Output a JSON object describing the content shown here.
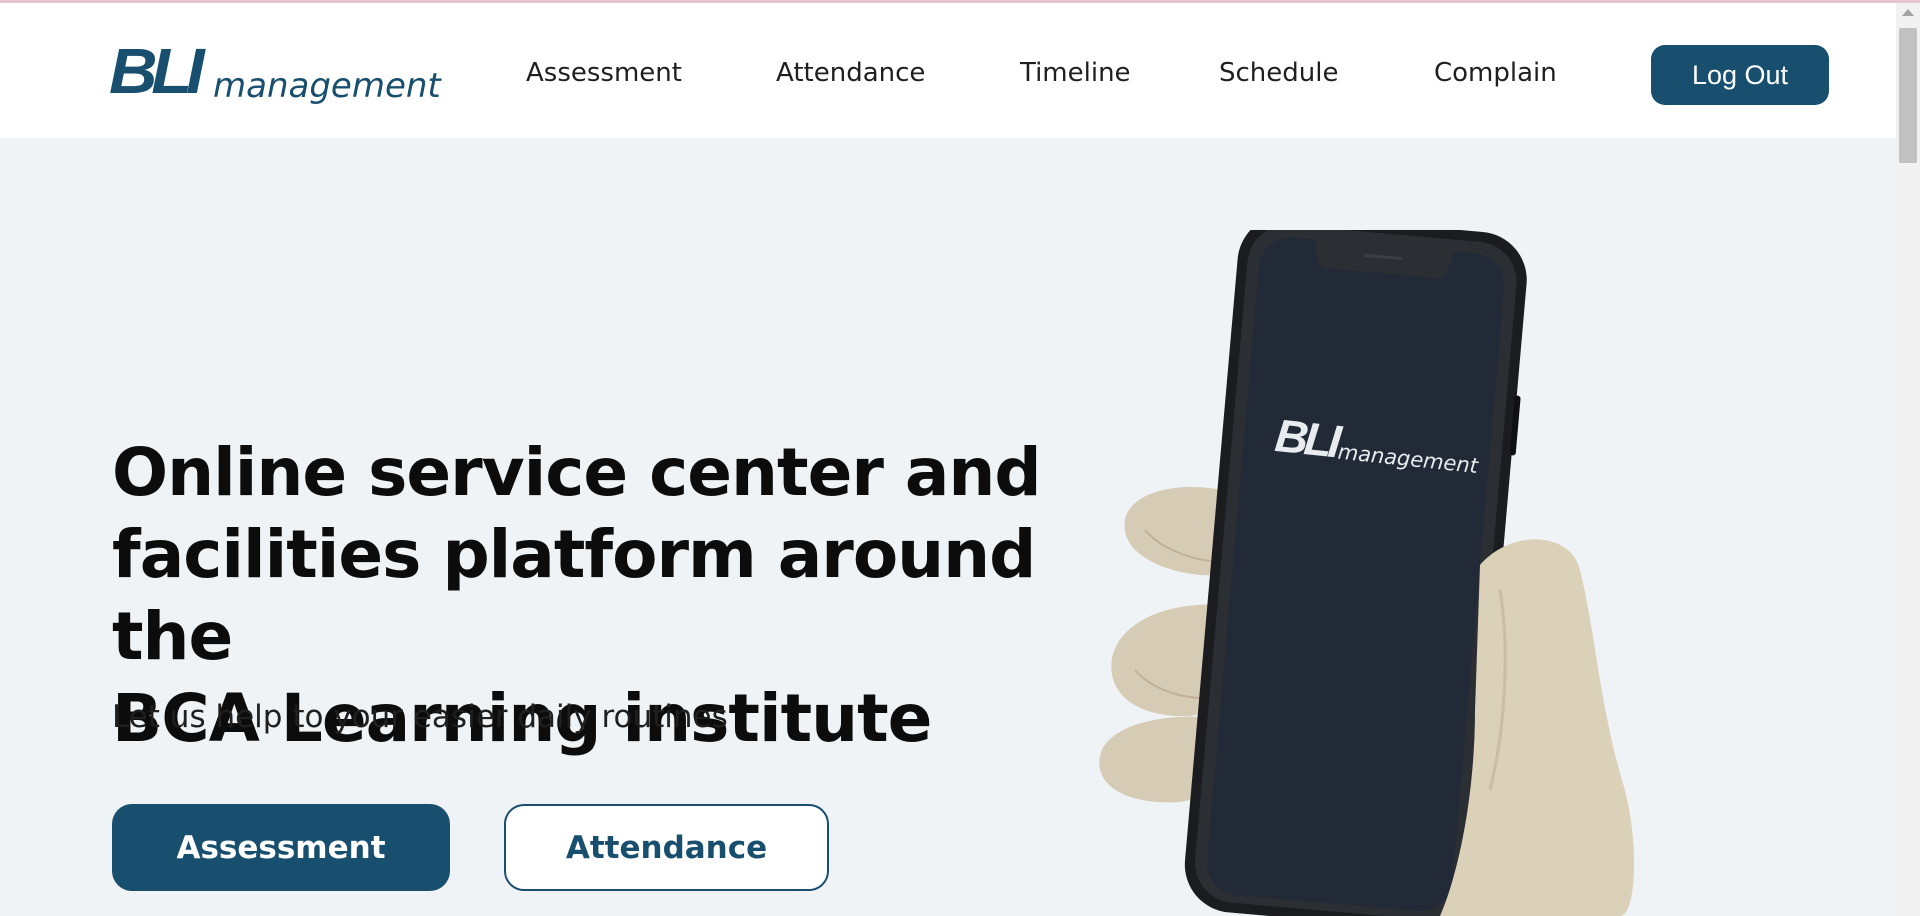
{
  "brand": {
    "logo_mark": "BLI",
    "logo_word": "management",
    "accent_color": "#184f6e"
  },
  "nav": {
    "items": [
      "Assessment",
      "Attendance",
      "Timeline",
      "Schedule",
      "Complain"
    ],
    "logout_label": "Log Out"
  },
  "hero": {
    "title_lines": [
      "Online service center and",
      "facilities platform around the",
      "BCA Learning institute"
    ],
    "subtitle": "Let us help to your easier daily routines",
    "primary_button": "Assessment",
    "secondary_button": "Attendance"
  },
  "phone_screen": {
    "logo_mark": "BLI",
    "logo_word": "management"
  }
}
